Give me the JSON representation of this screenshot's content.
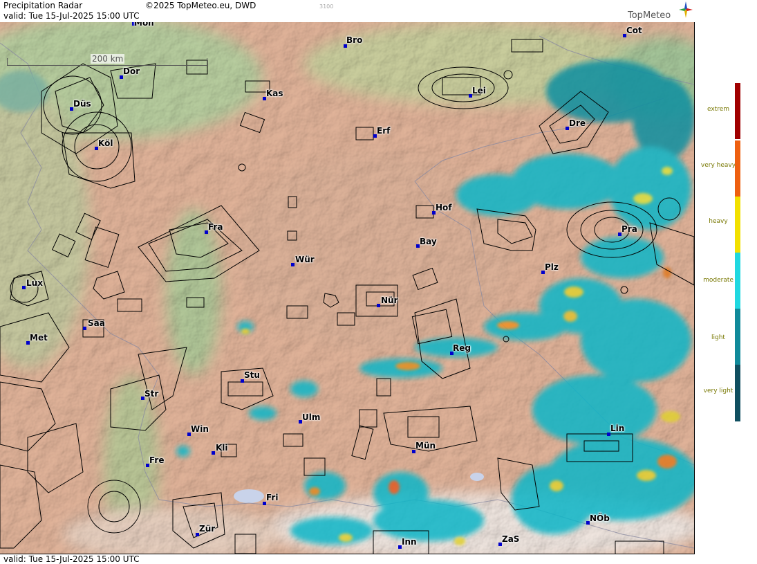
{
  "header": {
    "title": "Precipitation Radar",
    "copyright": "©2025 TopMeteo.eu, DWD",
    "valid": "valid:  Tue  15-Jul-2025 15:00 UTC",
    "code": "3100",
    "brand": "TopMeteo"
  },
  "footer": {
    "valid": "valid:  Tue  15-Jul-2025 15:00 UTC"
  },
  "scale": {
    "label": "200 km"
  },
  "legend": {
    "levels": [
      {
        "label": "extrem",
        "color": "#a00000"
      },
      {
        "label": "very heavy",
        "color": "#ee6010"
      },
      {
        "label": "heavy",
        "color": "#f2e000"
      },
      {
        "label": "moderate",
        "color": "#20d8e0"
      },
      {
        "label": "light",
        "color": "#108a9a"
      },
      {
        "label": "very light",
        "color": "#104f60"
      }
    ]
  },
  "cities": [
    {
      "name": "Mon"
    },
    {
      "name": "Bro"
    },
    {
      "name": "Cot"
    },
    {
      "name": "Dor"
    },
    {
      "name": "Kas"
    },
    {
      "name": "Lei"
    },
    {
      "name": "Düs"
    },
    {
      "name": "Erf"
    },
    {
      "name": "Dre"
    },
    {
      "name": "Köl"
    },
    {
      "name": "Hof"
    },
    {
      "name": "Fra"
    },
    {
      "name": "Pra"
    },
    {
      "name": "Bay"
    },
    {
      "name": "Wür"
    },
    {
      "name": "Plz"
    },
    {
      "name": "Lux"
    },
    {
      "name": "Nür"
    },
    {
      "name": "Saa"
    },
    {
      "name": "Met"
    },
    {
      "name": "Reg"
    },
    {
      "name": "Stu"
    },
    {
      "name": "Str"
    },
    {
      "name": "Ulm"
    },
    {
      "name": "Win"
    },
    {
      "name": "Lin"
    },
    {
      "name": "Kli"
    },
    {
      "name": "Mün"
    },
    {
      "name": "Fre"
    },
    {
      "name": "Fri"
    },
    {
      "name": "NÖb"
    },
    {
      "name": "Zür"
    },
    {
      "name": "ZaS"
    },
    {
      "name": "Inn"
    }
  ]
}
